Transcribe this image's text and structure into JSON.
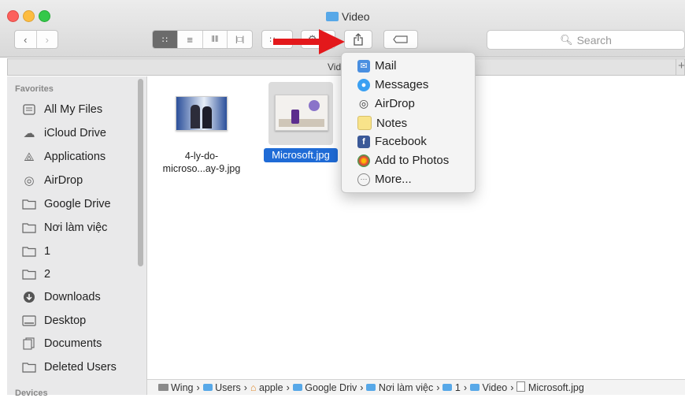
{
  "window": {
    "title": "Video"
  },
  "toolbar": {
    "search_placeholder": "Search"
  },
  "pathbar": {
    "label": "Vid"
  },
  "sidebar": {
    "heading": "Favorites",
    "items": [
      {
        "label": "All My Files",
        "icon": "all-files-icon"
      },
      {
        "label": "iCloud Drive",
        "icon": "cloud-icon"
      },
      {
        "label": "Applications",
        "icon": "applications-icon"
      },
      {
        "label": "AirDrop",
        "icon": "airdrop-icon"
      },
      {
        "label": "Google Drive",
        "icon": "folder-icon"
      },
      {
        "label": "Nơi làm việc",
        "icon": "folder-icon"
      },
      {
        "label": "1",
        "icon": "folder-icon"
      },
      {
        "label": "2",
        "icon": "folder-icon"
      },
      {
        "label": "Downloads",
        "icon": "downloads-icon"
      },
      {
        "label": "Desktop",
        "icon": "desktop-icon"
      },
      {
        "label": "Documents",
        "icon": "documents-icon"
      },
      {
        "label": "Deleted Users",
        "icon": "folder-icon"
      }
    ],
    "next_heading": "Devices"
  },
  "files": [
    {
      "name_line1": "4-ly-do-",
      "name_line2": "microso...ay-9.jpg",
      "selected": false
    },
    {
      "name_line1": "Microsoft.jpg",
      "selected": true
    }
  ],
  "share_menu": {
    "items": [
      {
        "label": "Mail",
        "icon": "mail-icon"
      },
      {
        "label": "Messages",
        "icon": "messages-icon"
      },
      {
        "label": "AirDrop",
        "icon": "airdrop-icon"
      },
      {
        "label": "Notes",
        "icon": "notes-icon"
      },
      {
        "label": "Facebook",
        "icon": "facebook-icon"
      },
      {
        "label": "Add to Photos",
        "icon": "photos-icon"
      },
      {
        "label": "More...",
        "icon": "more-icon"
      }
    ]
  },
  "status_path": [
    "Wing",
    "Users",
    "apple",
    "Google Drive",
    "Nơi làm việc",
    "1",
    "Video",
    "Microsoft.jpg"
  ],
  "colors": {
    "selection": "#1f6bd6",
    "arrow": "#e3181b",
    "folder": "#57a8e8"
  }
}
